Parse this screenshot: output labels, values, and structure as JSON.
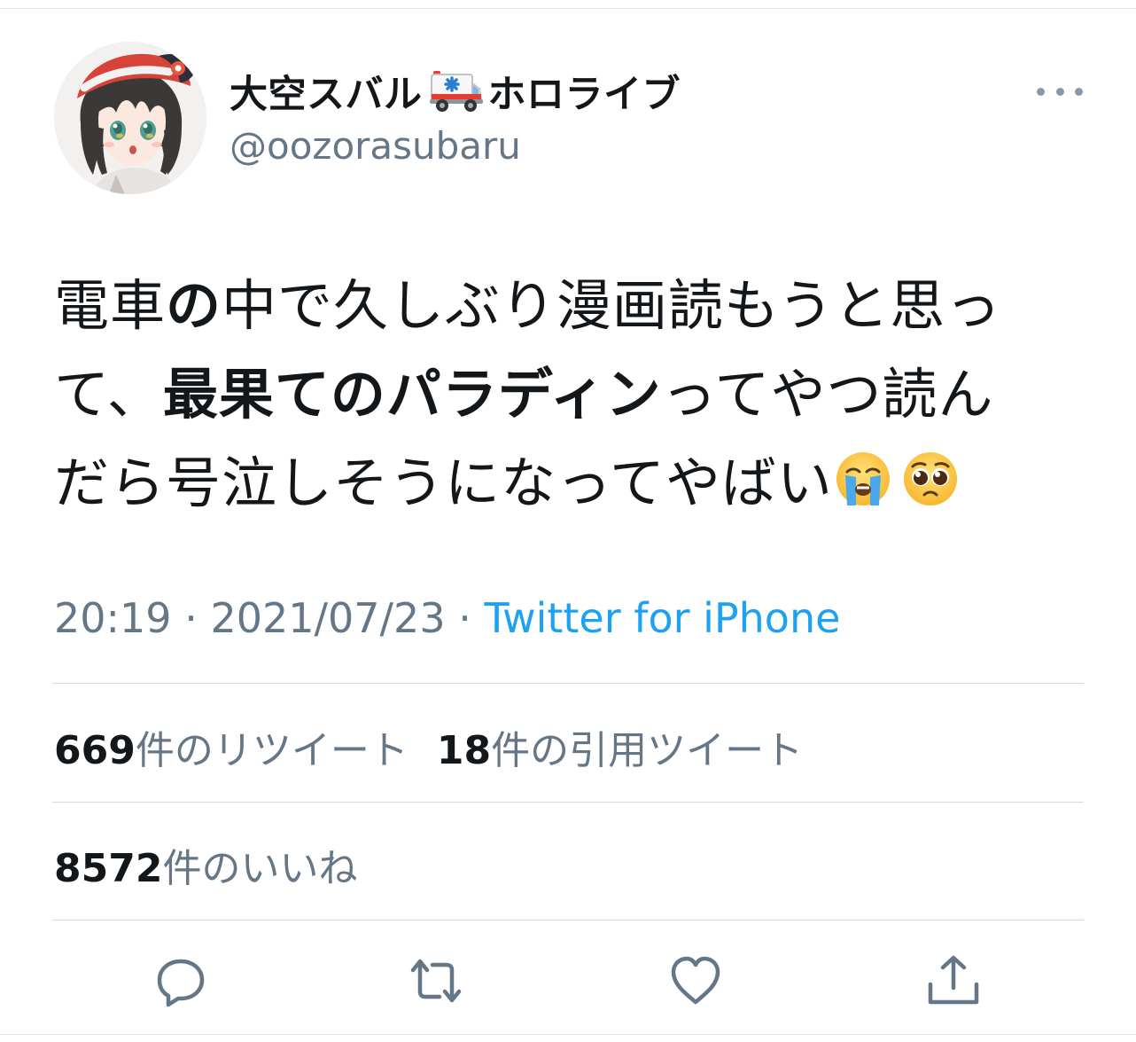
{
  "tweet": {
    "author": {
      "name_before_icon": "大空スバル",
      "name_icon": "ambulance-emoji",
      "name_after_icon": "ホロライブ",
      "handle": "@oozorasubaru"
    },
    "text_lines": [
      [
        {
          "text": "電車",
          "bold": false
        },
        {
          "text": "の",
          "bold": true
        },
        {
          "text": "中で久しぶり漫画読もうと思っ",
          "bold": false
        }
      ],
      [
        {
          "text": "て、",
          "bold": false
        },
        {
          "text": "最果てのパラディン",
          "bold": true
        },
        {
          "text": "ってやつ読ん",
          "bold": false
        }
      ],
      [
        {
          "text": "だら号泣しそうになってやばい",
          "bold": false
        }
      ]
    ],
    "emojis": [
      "loudly-crying-face",
      "pleading-face"
    ],
    "time": "20:19",
    "separator": "·",
    "date": "2021/07/23",
    "source": "Twitter for iPhone",
    "retweets": {
      "count": "669",
      "label": "件のリツイート"
    },
    "quotes": {
      "count": "18",
      "label": "件の引用ツイート"
    },
    "likes": {
      "count": "8572",
      "label": "件のいいね"
    }
  },
  "actions": [
    "reply-icon",
    "retweet-icon",
    "like-icon",
    "share-icon"
  ],
  "colors": {
    "text": "#14171a",
    "secondary": "#657786",
    "link": "#1da1f2",
    "icon": "#657786",
    "divider": "#d6dadd"
  }
}
